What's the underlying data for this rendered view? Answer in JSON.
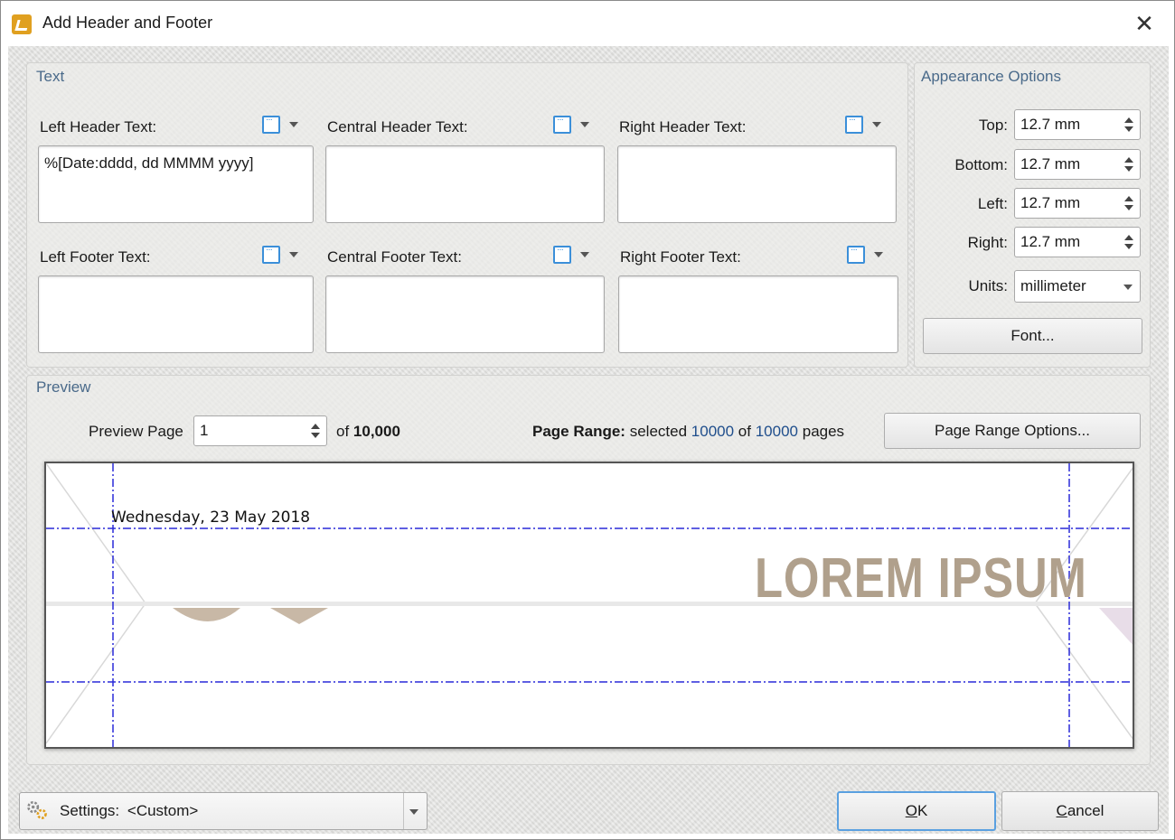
{
  "window": {
    "title": "Add Header and Footer",
    "close_glyph": "✕"
  },
  "text_group": {
    "title": "Text",
    "left_header_label": "Left Header Text:",
    "central_header_label": "Central Header Text:",
    "right_header_label": "Right Header Text:",
    "left_footer_label": "Left Footer Text:",
    "central_footer_label": "Central Footer Text:",
    "right_footer_label": "Right Footer Text:",
    "left_header_value": "%[Date:dddd, dd MMMM yyyy]",
    "central_header_value": "",
    "right_header_value": "",
    "left_footer_value": "",
    "central_footer_value": "",
    "right_footer_value": ""
  },
  "appearance": {
    "title": "Appearance Options",
    "top_label": "Top:",
    "top_value": "12.7 mm",
    "bottom_label": "Bottom:",
    "bottom_value": "12.7 mm",
    "left_label": "Left:",
    "left_value": "12.7 mm",
    "right_label": "Right:",
    "right_value": "12.7 mm",
    "units_label": "Units:",
    "units_value": "millimeter",
    "font_button": "Font..."
  },
  "preview": {
    "title": "Preview",
    "preview_page_label": "Preview Page",
    "preview_page_value": "1",
    "of_label": "of",
    "total_pages": "10,000",
    "page_range_label": "Page Range:",
    "page_range_selected_word": "selected",
    "page_range_selected": "10000",
    "page_range_of": "of",
    "page_range_total": "10000",
    "page_range_pages_word": "pages",
    "page_range_button": "Page Range Options...",
    "date_text": "Wednesday, 23 May 2018",
    "lorem_text": "LOREM IPSUM"
  },
  "footer": {
    "settings_label": "Settings:",
    "settings_value": "<Custom>",
    "ok_mnemonic": "O",
    "ok_rest": "K",
    "cancel_mnemonic": "C",
    "cancel_rest": "ancel"
  },
  "colors": {
    "accent_blue": "#3b8fd9",
    "link_blue": "#1f4e8c",
    "group_title": "#4a6a8a",
    "margin_guide": "#2a2ad8",
    "lorem": "#b0a08c"
  }
}
